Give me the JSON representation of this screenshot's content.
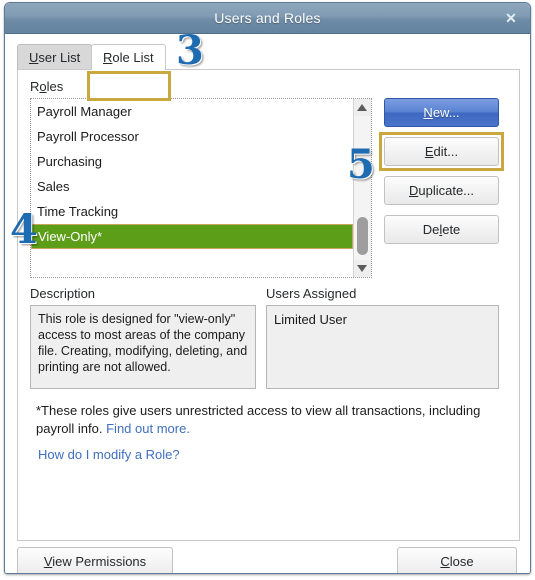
{
  "window": {
    "title": "Users and Roles",
    "close_icon": "close-icon",
    "close_glyph": "✕"
  },
  "tabs": [
    {
      "label": "User List",
      "accel": "U",
      "rest": "ser List",
      "active": false
    },
    {
      "label": "Role List",
      "accel": "R",
      "rest": "ole List",
      "active": true
    }
  ],
  "roles_section": {
    "label_accel_pre": "R",
    "label_accel": "o",
    "label_accel_post": "les",
    "label": "Roles",
    "items": [
      "Payroll Manager",
      "Payroll Processor",
      "Purchasing",
      "Sales",
      "Time Tracking",
      "View-Only*"
    ],
    "selected_item": "View-Only*",
    "selected_index": 5,
    "selection_bg": "#5d9e19",
    "selection_border": "#c5a65c",
    "scrollbar": {
      "up_icon": "scroll-up-arrow-icon",
      "down_icon": "scroll-down-arrow-icon",
      "thumb_icon": "scrollbar-thumb"
    }
  },
  "side_buttons": [
    {
      "name": "new",
      "accel": "N",
      "pre": "",
      "post": "ew...",
      "label": "New...",
      "style": "primary"
    },
    {
      "name": "edit",
      "accel": "E",
      "pre": "",
      "post": "dit...",
      "label": "Edit...",
      "style": "gray"
    },
    {
      "name": "duplicate",
      "accel": "D",
      "pre": "",
      "post": "uplicate...",
      "label": "Duplicate...",
      "style": "gray"
    },
    {
      "name": "delete",
      "accel": "l",
      "pre": "De",
      "post": "ete",
      "label": "Delete",
      "style": "gray"
    }
  ],
  "description": {
    "label": "Description",
    "text": "This role is designed for \"view-only\" access to most areas of the company file. Creating, modifying, deleting, and printing are not allowed."
  },
  "users_assigned": {
    "label": "Users Assigned",
    "items": [
      "Limited User"
    ],
    "first_item": "Limited User"
  },
  "footnote": {
    "text": "*These roles give users unrestricted access to view all transactions, including payroll info.",
    "link": "Find out more.",
    "howto_link": "How do I modify a Role?"
  },
  "bottom_buttons": {
    "view_permissions": {
      "accel": "V",
      "post": "iew Permissions",
      "label": "View Permissions"
    },
    "close": {
      "accel": "C",
      "post": "lose",
      "label": "Close"
    }
  },
  "annotations": [
    {
      "id": "3",
      "value": "3",
      "target": "role-list-tab"
    },
    {
      "id": "4",
      "value": "4",
      "target": "roles-list-selection"
    },
    {
      "id": "5",
      "value": "5",
      "target": "edit-button"
    }
  ],
  "colors": {
    "titlebar_top": "#8fa7bd",
    "titlebar_bottom": "#63839f",
    "highlight_gold": "#c9a83f",
    "primary_blue": "#4a74cc",
    "selection_green": "#5d9e19",
    "link_blue": "#3f6fbd",
    "annotation_blue": "#1d6bb0"
  }
}
